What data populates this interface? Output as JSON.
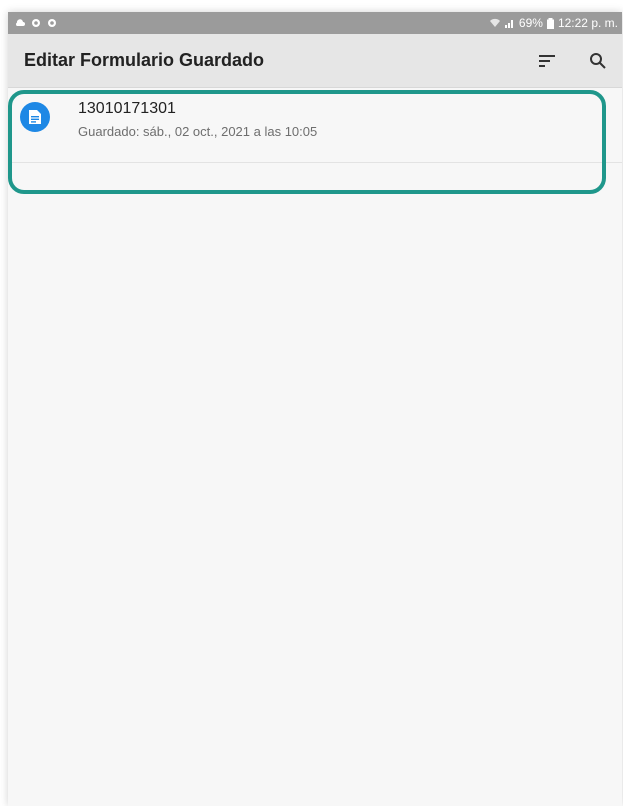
{
  "status_bar": {
    "battery": "69%",
    "time": "12:22 p. m."
  },
  "app_bar": {
    "title": "Editar Formulario Guardado",
    "icons": [
      "sort-icon",
      "search-icon"
    ]
  },
  "forms": [
    {
      "name": "13010171301",
      "saved": "Guardado: sáb., 02 oct., 2021 a las 10:05",
      "icon": "document-icon"
    }
  ],
  "colors": {
    "accent": "#1e88e5",
    "highlight": "#1f978b",
    "status_bar": "#9b9b9b",
    "app_bar": "#e6e6e6"
  }
}
